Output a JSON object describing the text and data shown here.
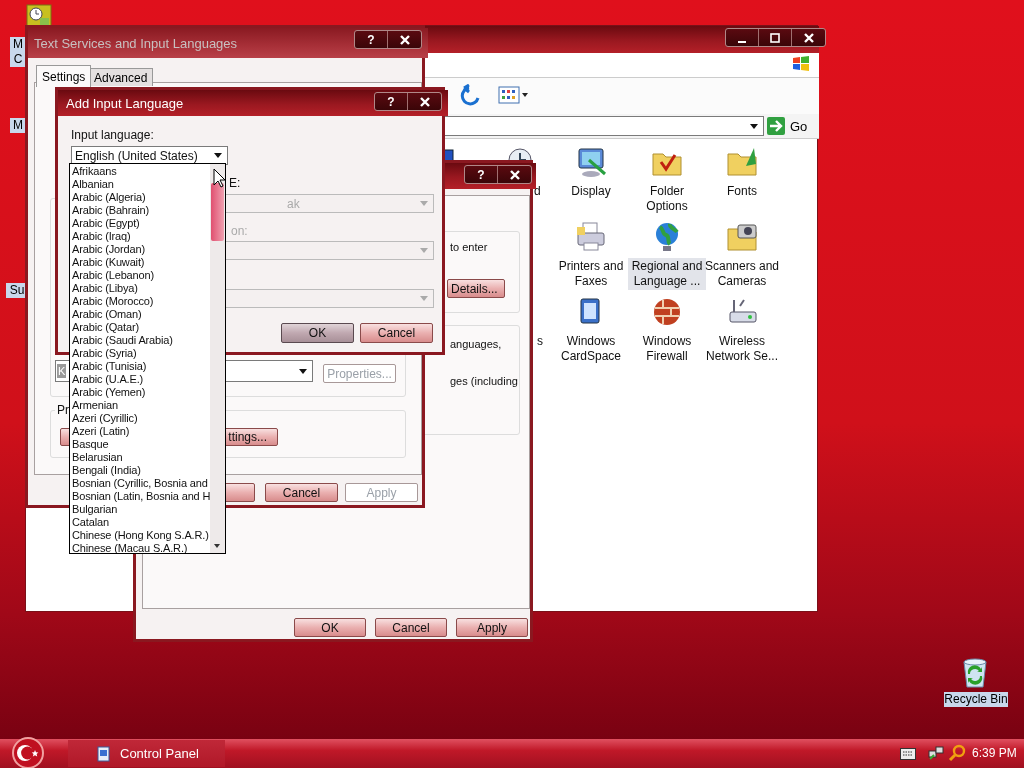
{
  "desktop": {
    "icons": [
      {
        "kind": "fragment",
        "label_lines": [
          "M",
          "C"
        ]
      },
      {
        "kind": "fragment",
        "label_lines": [
          "M"
        ]
      },
      {
        "kind": "fragment",
        "label_lines": [
          "Su"
        ]
      },
      {
        "kind": "recycle",
        "label_lines": [
          "Recycle Bin"
        ]
      }
    ]
  },
  "control_panel": {
    "go_label": "Go",
    "items": [
      {
        "kind": "monitor",
        "selected": false
      },
      {
        "kind": "clock",
        "label": "d",
        "selected": false
      },
      {
        "kind": "display",
        "label": "Display",
        "selected": false
      },
      {
        "kind": "folder-check",
        "label": "Folder Options",
        "selected": false
      },
      {
        "kind": "folder-fonts",
        "label": "Fonts",
        "selected": false
      },
      {
        "kind": "printer",
        "label": "Printers and Faxes",
        "selected": false
      },
      {
        "kind": "globe",
        "label": "Regional and Language ...",
        "selected": true
      },
      {
        "kind": "scanner",
        "label": "Scanners and Cameras",
        "selected": false
      },
      {
        "kind": "hidden",
        "label": "s",
        "selected": false
      },
      {
        "kind": "card",
        "label": "Windows CardSpace",
        "selected": false
      },
      {
        "kind": "firewall",
        "label": "Windows Firewall",
        "selected": false
      },
      {
        "kind": "wireless",
        "label": "Wireless Network Se...",
        "selected": false
      }
    ]
  },
  "regional_dialog": {
    "help": "?",
    "texts": [
      "to enter",
      "anguages,",
      "ges (including"
    ],
    "details_button": "Details...",
    "buttons": [
      {
        "label": "OK",
        "disabled": false
      },
      {
        "label": "Cancel",
        "disabled": false
      },
      {
        "label": "Apply",
        "disabled": false
      }
    ]
  },
  "text_services": {
    "title": "Text Services and Input Languages",
    "active": false,
    "help": "?",
    "tabs": [
      {
        "label": "Settings",
        "selected": true
      },
      {
        "label": "Advanced",
        "selected": false
      }
    ],
    "layout_value": "K",
    "properties_button": {
      "label": "Properties...",
      "disabled": true
    },
    "group_label": "Pr",
    "settings_button": "ttings...",
    "buttons": [
      {
        "label": "Cancel",
        "disabled": false
      },
      {
        "label": "Apply",
        "disabled": true
      }
    ]
  },
  "add_language": {
    "title": "Add Input Language",
    "active": true,
    "help": "?",
    "input_label": "Input language:",
    "input_value": "English (United States)",
    "layout_label": "E:",
    "layout_value": "ak",
    "layout_disabled": true,
    "option_label": "on:",
    "option_disabled": true,
    "buttons": [
      {
        "label": "OK",
        "default": true
      },
      {
        "label": "Cancel",
        "default": false
      }
    ],
    "list": {
      "items": [
        "Afrikaans",
        "Albanian",
        "Arabic (Algeria)",
        "Arabic (Bahrain)",
        "Arabic (Egypt)",
        "Arabic (Iraq)",
        "Arabic (Jordan)",
        "Arabic (Kuwait)",
        "Arabic (Lebanon)",
        "Arabic (Libya)",
        "Arabic (Morocco)",
        "Arabic (Oman)",
        "Arabic (Qatar)",
        "Arabic (Saudi Arabia)",
        "Arabic (Syria)",
        "Arabic (Tunisia)",
        "Arabic (U.A.E.)",
        "Arabic (Yemen)",
        "Armenian",
        "Azeri (Cyrillic)",
        "Azeri (Latin)",
        "Basque",
        "Belarusian",
        "Bengali (India)",
        "Bosnian (Cyrillic, Bosnia and",
        "Bosnian (Latin, Bosnia and H",
        "Bulgarian",
        "Catalan",
        "Chinese (Hong Kong S.A.R.)",
        "Chinese (Macau S.A.R.)"
      ]
    }
  },
  "taskbar": {
    "tasks": [
      {
        "label": "Control Panel",
        "selected": false
      }
    ],
    "clock": "6:39 PM"
  }
}
